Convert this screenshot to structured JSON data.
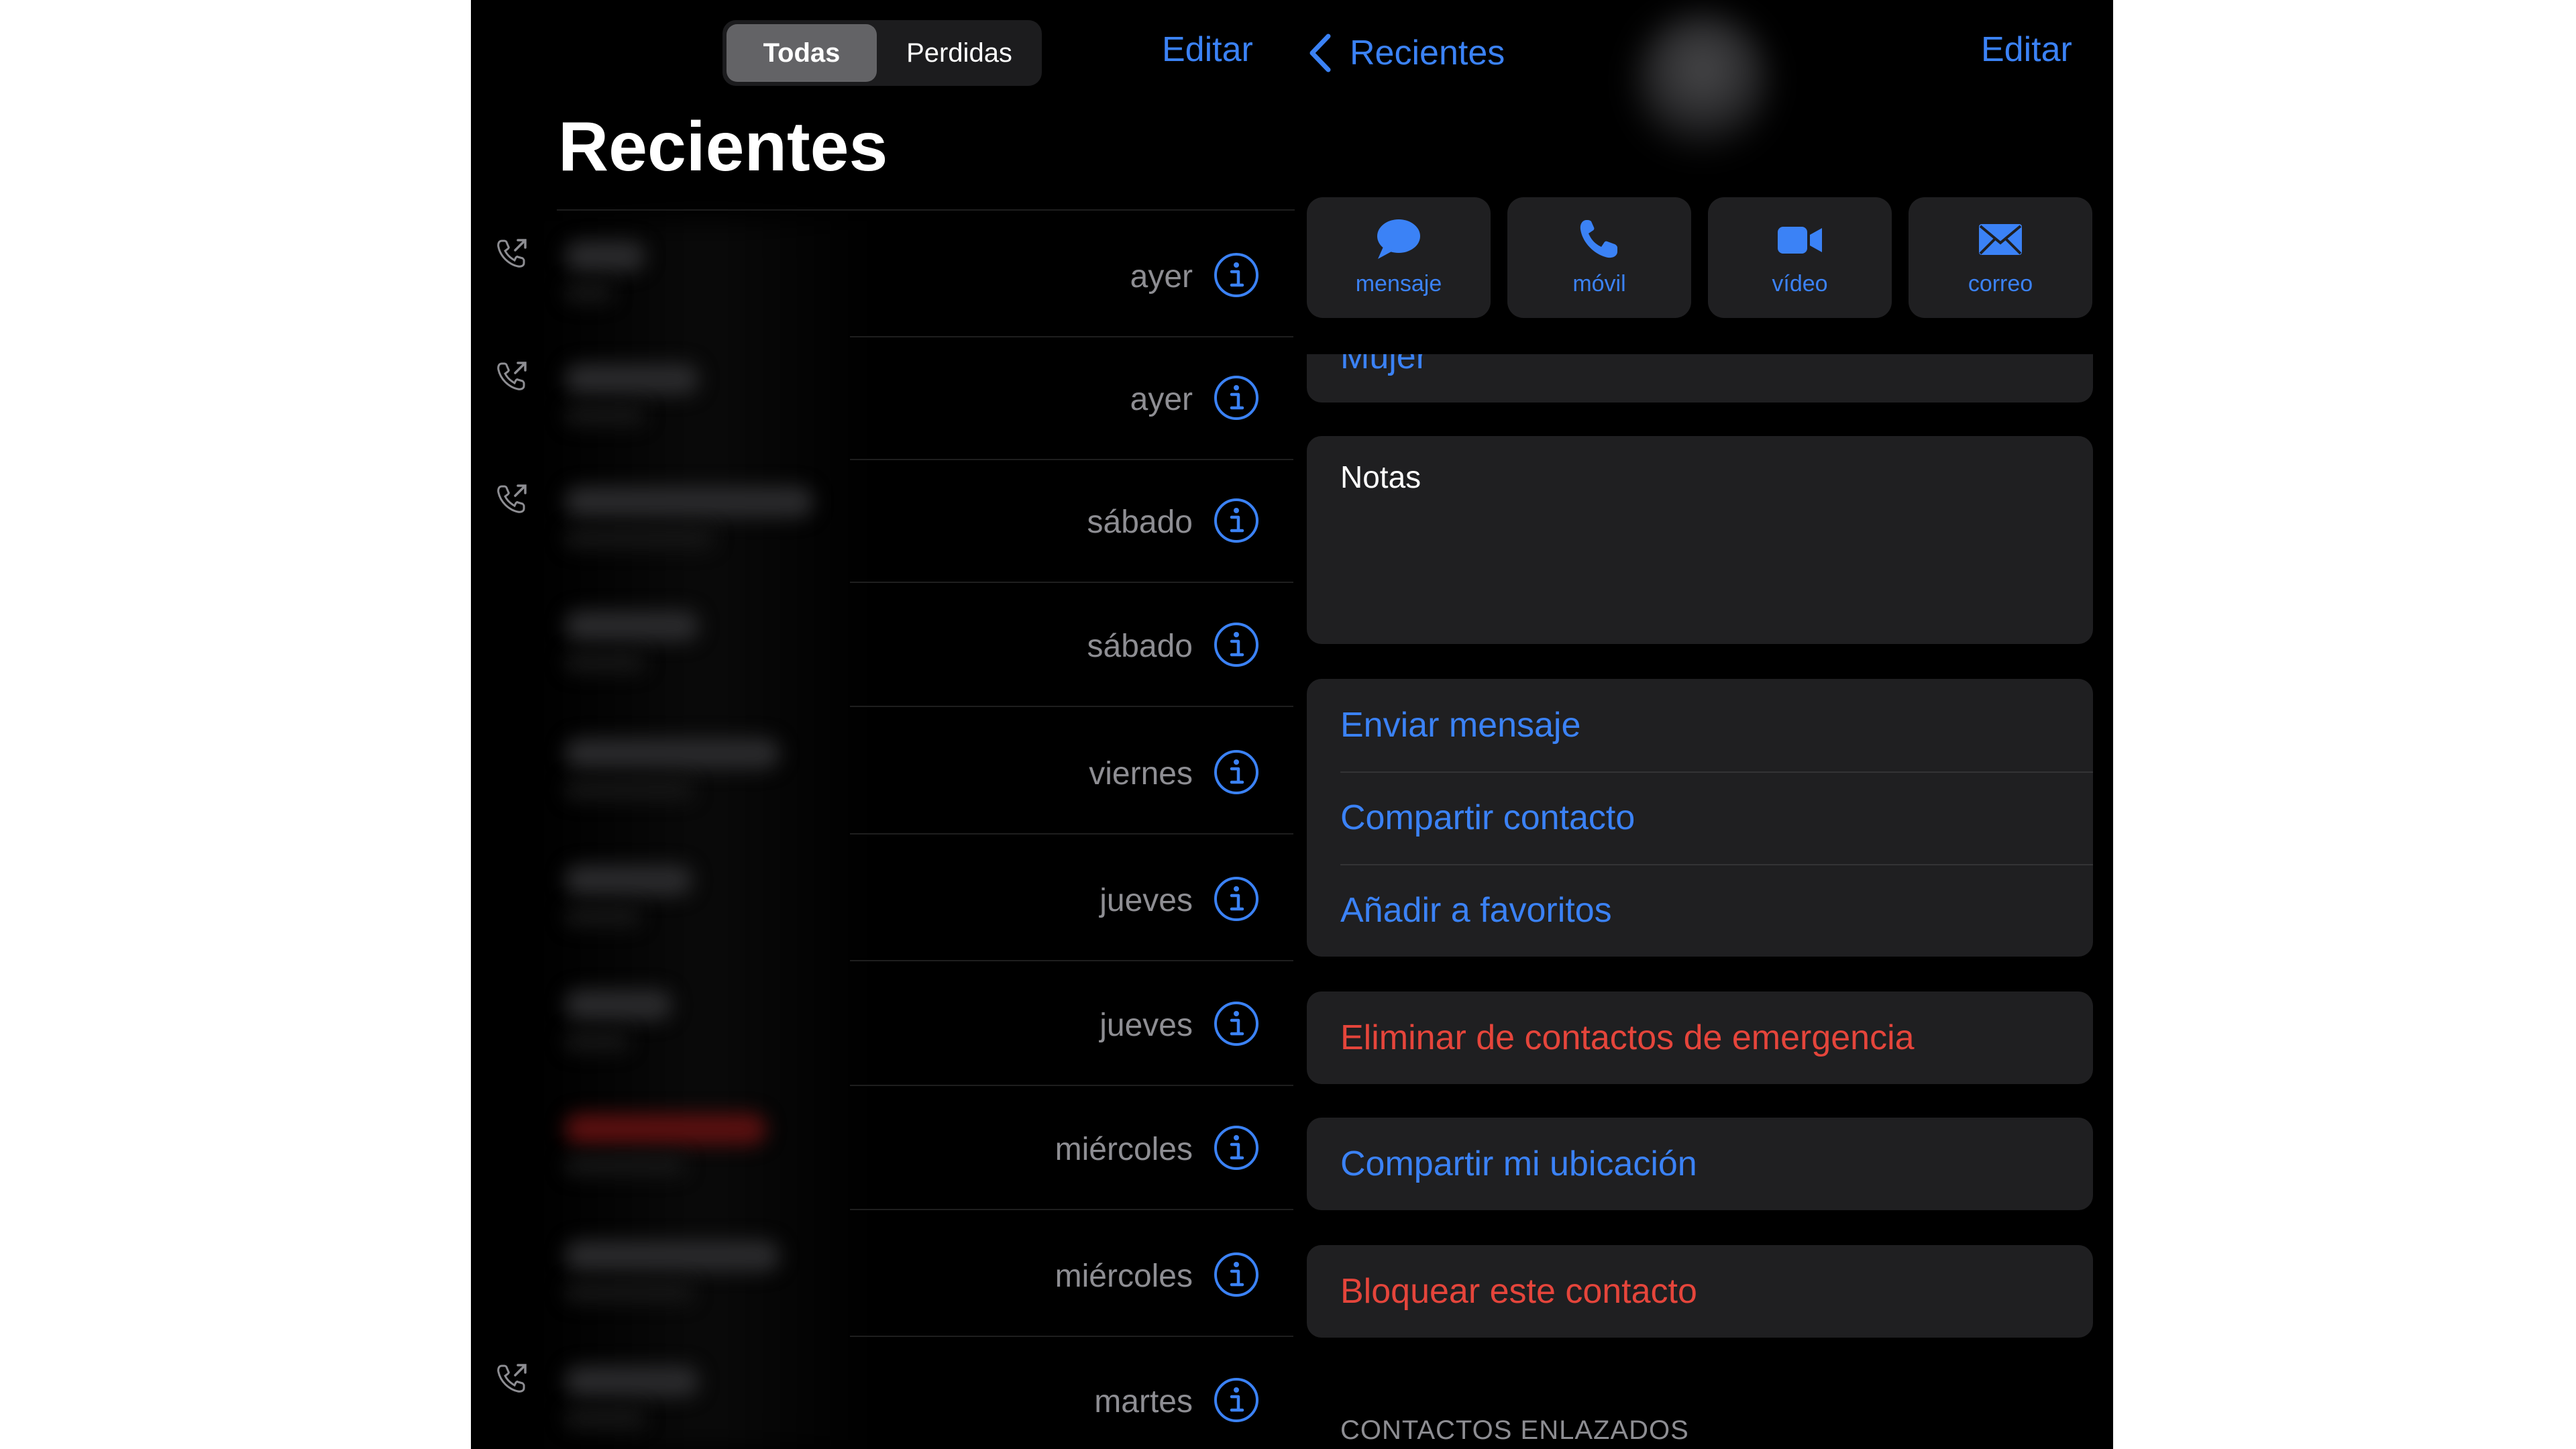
{
  "left": {
    "segments": {
      "all": "Todas",
      "missed": "Perdidas"
    },
    "edit_label": "Editar",
    "title": "Recientes",
    "calls": [
      {
        "date": "ayer",
        "outgoing": true,
        "missed": false
      },
      {
        "date": "ayer",
        "outgoing": true,
        "missed": false
      },
      {
        "date": "sábado",
        "outgoing": true,
        "missed": false
      },
      {
        "date": "sábado",
        "outgoing": false,
        "missed": false
      },
      {
        "date": "viernes",
        "outgoing": false,
        "missed": false
      },
      {
        "date": "jueves",
        "outgoing": false,
        "missed": false
      },
      {
        "date": "jueves",
        "outgoing": false,
        "missed": false
      },
      {
        "date": "miércoles",
        "outgoing": false,
        "missed": true
      },
      {
        "date": "miércoles",
        "outgoing": false,
        "missed": false
      },
      {
        "date": "martes",
        "outgoing": true,
        "missed": false
      }
    ]
  },
  "right": {
    "back_label": "Recientes",
    "edit_label": "Editar",
    "actions": [
      {
        "label": "mensaje",
        "icon": "message-bubble-icon"
      },
      {
        "label": "móvil",
        "icon": "phone-icon"
      },
      {
        "label": "vídeo",
        "icon": "video-camera-icon"
      },
      {
        "label": "correo",
        "icon": "mail-envelope-icon"
      }
    ],
    "partial_field": "Mujer",
    "notes_label": "Notas",
    "list_actions": [
      "Enviar mensaje",
      "Compartir contacto",
      "Añadir a favoritos"
    ],
    "emergency_label": "Eliminar de contactos de emergencia",
    "share_location_label": "Compartir mi ubicación",
    "block_label": "Bloquear este contacto",
    "linked_header": "CONTACTOS ENLAZADOS"
  },
  "colors": {
    "accent": "#3b82f6",
    "destructive": "#e5453b",
    "background": "#000000",
    "card": "#1f1f21",
    "secondary_text": "#8e8e93"
  }
}
